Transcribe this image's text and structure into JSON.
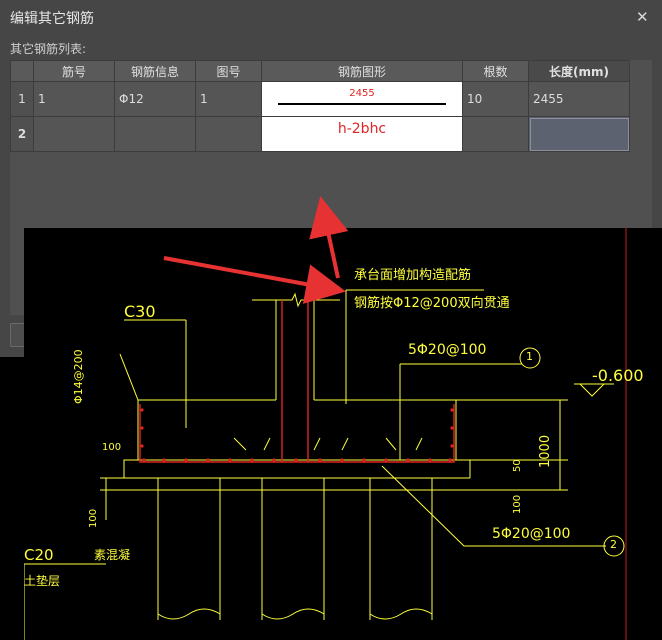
{
  "dialog": {
    "title": "编辑其它钢筋",
    "close_glyph": "✕",
    "list_label": "其它钢筋列表:",
    "columns": [
      "筋号",
      "钢筋信息",
      "图号",
      "钢筋图形",
      "根数",
      "长度(mm)"
    ],
    "rows": [
      {
        "index": "1",
        "bar_no": "1",
        "info": "Φ12",
        "fig_no": "1",
        "shape_number": "2455",
        "count": "10",
        "length": "2455"
      },
      {
        "index": "2",
        "bar_no": "",
        "info": "",
        "fig_no": "",
        "shape_code": "h-2bhc",
        "count": "",
        "length": ""
      }
    ]
  },
  "cad": {
    "concrete_cap": "C30",
    "concrete_bed": "C20",
    "plain_concrete": "素混凝",
    "cushion": "土垫层",
    "note_line1": "承台面增加构造配筋",
    "note_line2": "钢筋按Φ12@200双向贯通",
    "rebar_top": "5Φ20@100",
    "rebar_bottom": "5Φ20@100",
    "stirrup": "Φ14@200",
    "elevation": "-0.600",
    "marker_1": "1",
    "marker_2": "2",
    "dim_100_left": "100",
    "dim_100_bottom": "100",
    "dim_100_right": "100",
    "dim_1000": "1000",
    "dim_50": "50"
  },
  "colors": {
    "cad_line": "#ffff3c",
    "rebar": "#e02424",
    "arrow": "#e63232",
    "grid_red": "#c81e1e"
  }
}
